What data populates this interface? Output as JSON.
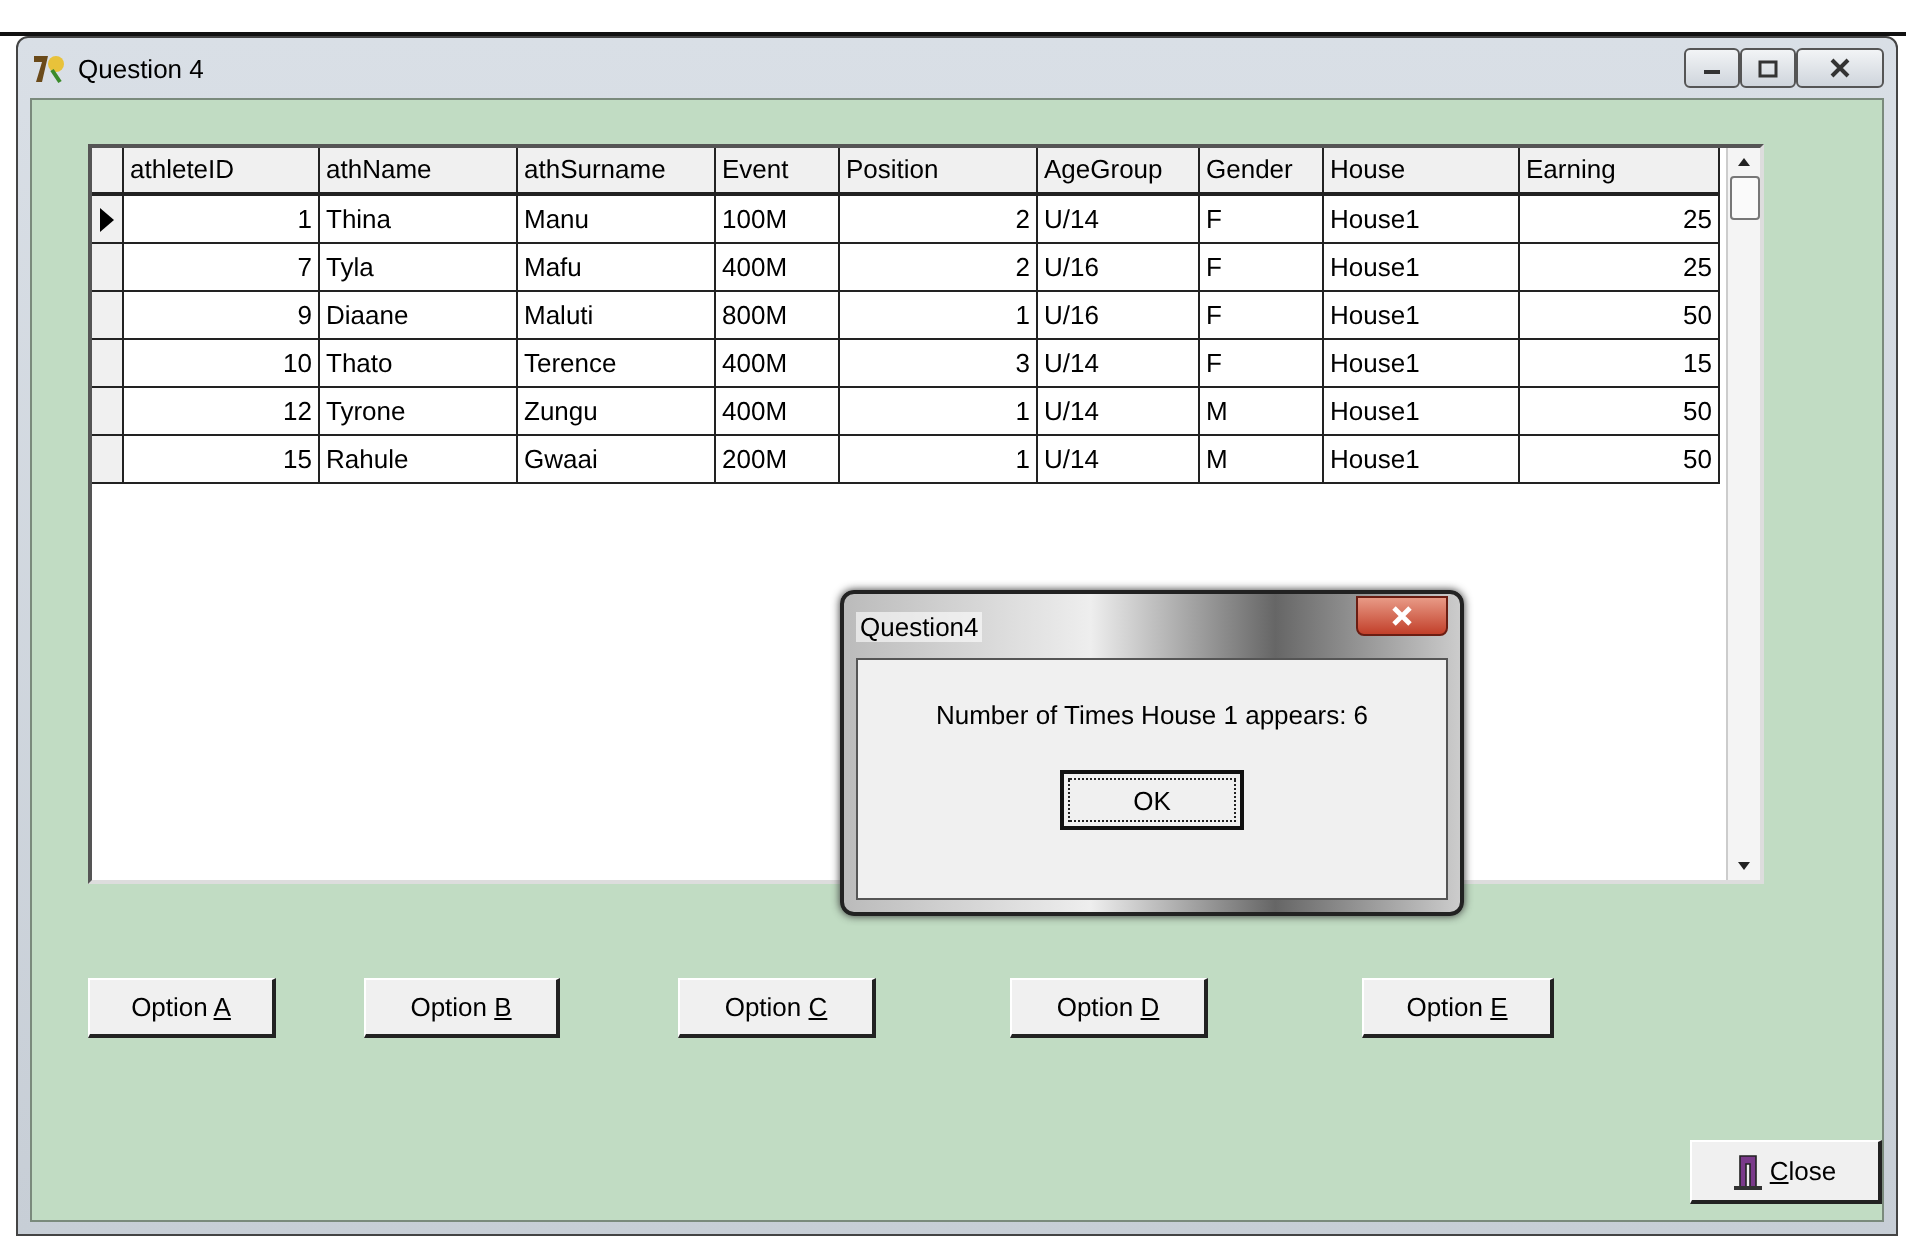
{
  "window": {
    "title": "Question 4"
  },
  "table": {
    "columns": [
      "athleteID",
      "athName",
      "athSurname",
      "Event",
      "Position",
      "AgeGroup",
      "Gender",
      "House",
      "Earning"
    ],
    "rows": [
      {
        "selected": true,
        "cells": [
          "1",
          "Thina",
          "Manu",
          "100M",
          "2",
          "U/14",
          "F",
          "House1",
          "25"
        ]
      },
      {
        "selected": false,
        "cells": [
          "7",
          "Tyla",
          "Mafu",
          "400M",
          "2",
          "U/16",
          "F",
          "House1",
          "25"
        ]
      },
      {
        "selected": false,
        "cells": [
          "9",
          "Diaane",
          "Maluti",
          "800M",
          "1",
          "U/16",
          "F",
          "House1",
          "50"
        ]
      },
      {
        "selected": false,
        "cells": [
          "10",
          "Thato",
          "Terence",
          "400M",
          "3",
          "U/14",
          "F",
          "House1",
          "15"
        ]
      },
      {
        "selected": false,
        "cells": [
          "12",
          "Tyrone",
          "Zungu",
          "400M",
          "1",
          "U/14",
          "M",
          "House1",
          "50"
        ]
      },
      {
        "selected": false,
        "cells": [
          "15",
          "Rahule",
          "Gwaai",
          "200M",
          "1",
          "U/14",
          "M",
          "House1",
          "50"
        ]
      }
    ]
  },
  "option_buttons": [
    {
      "label": "Option A",
      "underline_last_letter": true
    },
    {
      "label": "Option B",
      "underline_last_letter": true
    },
    {
      "label": "Option C",
      "underline_last_letter": true
    },
    {
      "label": "Option D",
      "underline_last_letter": true
    },
    {
      "label": "Option E",
      "underline_last_letter": true
    }
  ],
  "close_button": {
    "label": "Close",
    "underline_first_letter": true
  },
  "dialog": {
    "title": "Question4",
    "message": "Number of Times House 1 appears: 6",
    "button": "OK"
  }
}
